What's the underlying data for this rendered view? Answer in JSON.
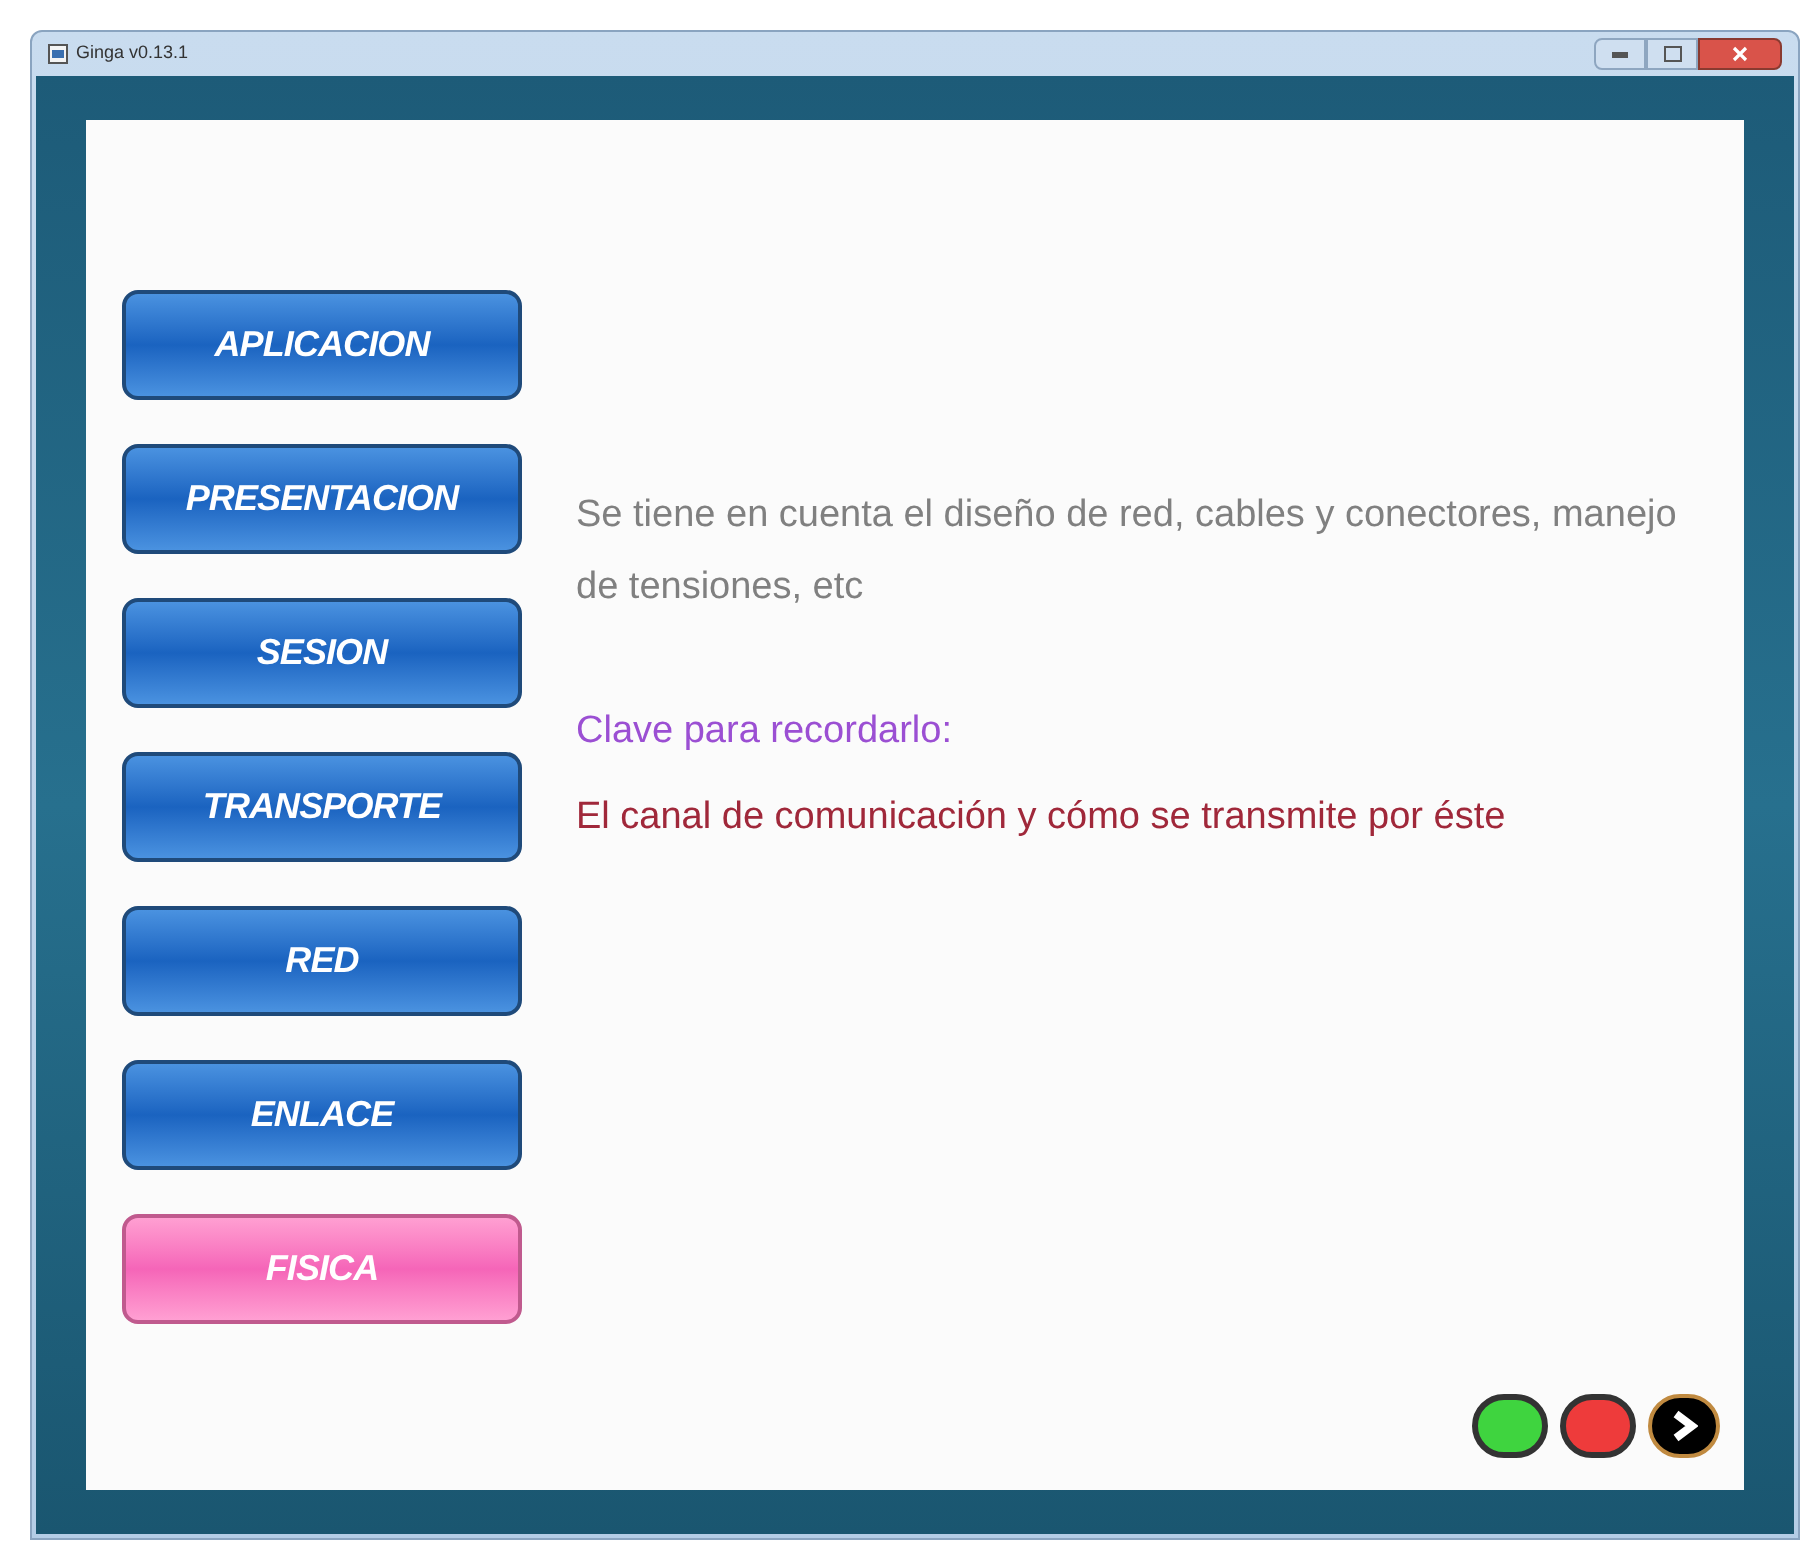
{
  "window": {
    "title": "Ginga v0.13.1"
  },
  "menu": [
    {
      "label": "APLICACION",
      "selected": false
    },
    {
      "label": "PRESENTACION",
      "selected": false
    },
    {
      "label": "SESION",
      "selected": false
    },
    {
      "label": "TRANSPORTE",
      "selected": false
    },
    {
      "label": "RED",
      "selected": false
    },
    {
      "label": "ENLACE",
      "selected": false
    },
    {
      "label": "FISICA",
      "selected": true
    }
  ],
  "description": "Se tiene en cuenta el  diseño de red, cables y conectores, manejo de tensiones, etc",
  "key_label": "Clave para recordarlo:",
  "key_text": "El canal de comunicación y cómo se transmite por éste",
  "controls": [
    {
      "kind": "dot",
      "color": "#3fd43f"
    },
    {
      "kind": "dot",
      "color": "#ee3b3b"
    },
    {
      "kind": "next"
    }
  ]
}
